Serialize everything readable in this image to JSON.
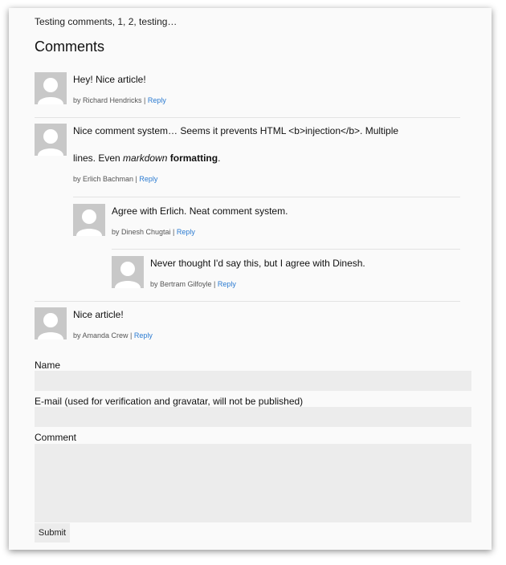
{
  "page": {
    "intro_text": "Testing comments, 1, 2, testing…",
    "heading": "Comments"
  },
  "comments": [
    {
      "text_line1": "Hey! Nice article!",
      "by": "by Richard Hendricks",
      "reply_label": "Reply"
    },
    {
      "text_line1": "Nice comment system… Seems it prevents HTML <b>injection</b>. Multiple",
      "text_line2_prefix": "lines. Even ",
      "text_line2_em": "markdown",
      "text_line2_space": " ",
      "text_line2_strong": "formatting",
      "text_line2_suffix": ".",
      "by": "by Erlich Bachman",
      "reply_label": "Reply"
    },
    {
      "text_line1": "Agree with Erlich. Neat comment system.",
      "by": "by Dinesh Chugtai",
      "reply_label": "Reply"
    },
    {
      "text_line1": "Never thought I'd say this, but I agree with Dinesh.",
      "by": "by Bertram Gilfoyle",
      "reply_label": "Reply"
    },
    {
      "text_line1": "Nice article!",
      "by": "by Amanda Crew",
      "reply_label": "Reply"
    }
  ],
  "form": {
    "name_label": "Name",
    "name_value": "",
    "email_label": "E-mail (used for verification and gravatar, will not be published)",
    "email_value": "",
    "comment_label": "Comment",
    "comment_value": "",
    "submit_label": "Submit"
  },
  "meta_separator": " | "
}
